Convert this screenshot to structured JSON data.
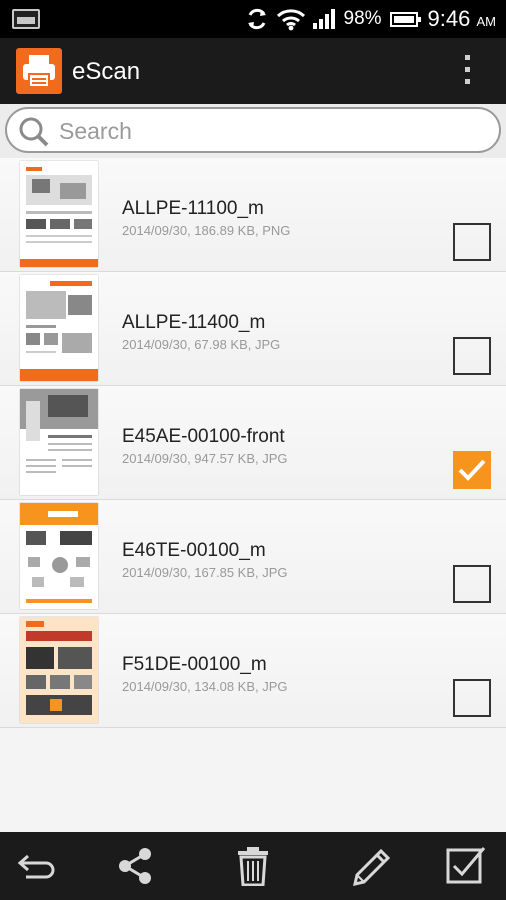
{
  "status_bar": {
    "battery": "98%",
    "time": "9:46",
    "ampm": "AM"
  },
  "app": {
    "title": "eScan",
    "logo_icon": "printer-icon"
  },
  "search": {
    "placeholder": "Search",
    "value": ""
  },
  "files": [
    {
      "name": "ALLPE-11100_m",
      "meta": "2014/09/30, 186.89 KB, PNG",
      "checked": false
    },
    {
      "name": "ALLPE-11400_m",
      "meta": "2014/09/30, 67.98 KB, JPG",
      "checked": false
    },
    {
      "name": "E45AE-00100-front",
      "meta": "2014/09/30, 947.57 KB, JPG",
      "checked": true
    },
    {
      "name": "E46TE-00100_m",
      "meta": "2014/09/30, 167.85 KB, JPG",
      "checked": false
    },
    {
      "name": "F51DE-00100_m",
      "meta": "2014/09/30, 134.08 KB, JPG",
      "checked": false
    }
  ],
  "toolbar": {
    "icons": [
      "back-icon",
      "share-icon",
      "trash-icon",
      "edit-icon",
      "select-all-icon"
    ]
  },
  "colors": {
    "accent": "#f7941e",
    "bar": "#1b1b1b",
    "brand": "#f26b1d"
  }
}
